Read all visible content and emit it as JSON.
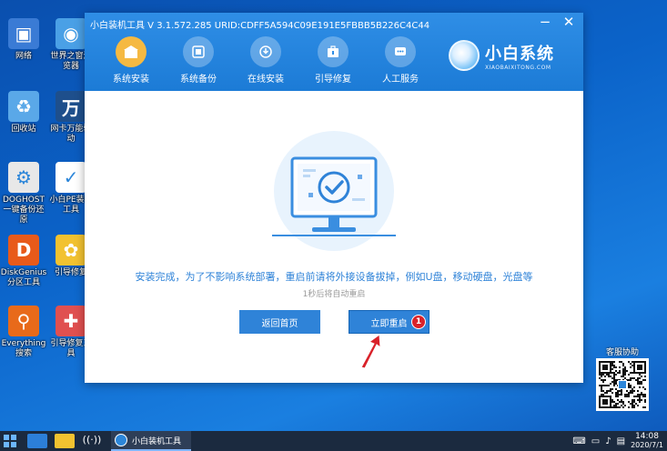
{
  "window": {
    "title": "小白装机工具 V 3.1.572.285 URID:CDFF5A594C09E191E5FBBB5B226C4C44",
    "minimize": "−",
    "close": "✕"
  },
  "nav": [
    {
      "label": "系统安装",
      "icon": "system-install-icon"
    },
    {
      "label": "系统备份",
      "icon": "system-backup-icon"
    },
    {
      "label": "在线安装",
      "icon": "online-install-icon"
    },
    {
      "label": "引导修复",
      "icon": "boot-repair-icon"
    },
    {
      "label": "人工服务",
      "icon": "human-service-icon"
    }
  ],
  "brand": {
    "name": "小白系统",
    "domain": "XIAOBAIXITONG.COM"
  },
  "main": {
    "message": "安装完成，为了不影响系统部署，重启前请将外接设备拔掉，例如U盘，移动硬盘，光盘等",
    "countdown": "1秒后将自动重启",
    "home_button": "返回首页",
    "restart_button": "立即重启",
    "badge": "1"
  },
  "desktop": [
    {
      "label": "网络",
      "color": "#3a7bd5",
      "glyph": "▣"
    },
    {
      "label": "世界之窗浏览器",
      "color": "#4aa0e6",
      "glyph": "◉"
    },
    {
      "label": "回收站",
      "color": "#5aa8e8",
      "glyph": "♻"
    },
    {
      "label": "网卡万能驱动",
      "color": "#1e4f8c",
      "glyph": "万"
    },
    {
      "label": "DOGHOST一键备份还原",
      "color": "#e8e8e8",
      "glyph": "⚙"
    },
    {
      "label": "小白PE装机工具",
      "color": "#ffffff",
      "glyph": "✓"
    },
    {
      "label": "DiskGenius分区工具",
      "color": "#e85a1a",
      "glyph": "D"
    },
    {
      "label": "引导修复",
      "color": "#f2c230",
      "glyph": "✿"
    },
    {
      "label": "Everything搜索",
      "color": "#e86a1a",
      "glyph": "⚲"
    },
    {
      "label": "引导修复工具",
      "color": "#e05050",
      "glyph": "✚"
    }
  ],
  "qr": {
    "label": "客服协助"
  },
  "taskbar": {
    "app_label": "小白装机工具",
    "time": "14:08",
    "date": "2020/7/1"
  },
  "colors": {
    "header": "#1c7bd6",
    "accent": "#2f83d8",
    "active_nav": "#f5b942",
    "badge": "#d9222a"
  }
}
